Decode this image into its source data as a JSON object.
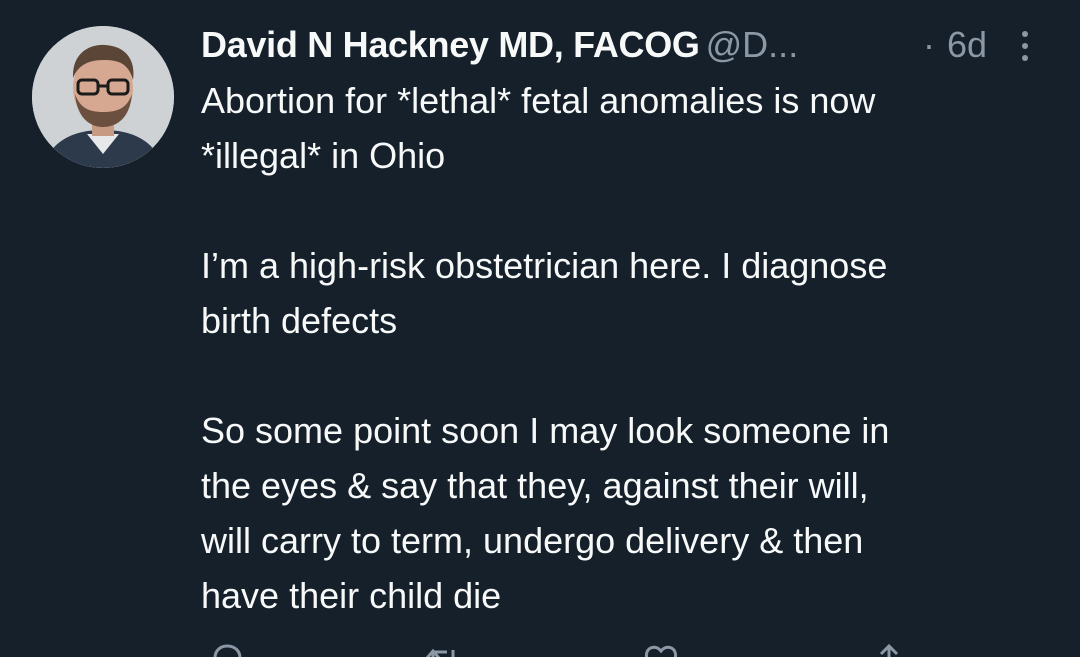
{
  "tweet": {
    "display_name": "David N Hackney MD, FACOG",
    "handle": "@D...",
    "separator": "·",
    "time": "6d",
    "more_icon": "more-vertical-icon",
    "paragraphs": [
      {
        "lines": [
          "Abortion for *lethal* fetal anomalies is now",
          "*illegal* in Ohio"
        ]
      },
      {
        "lines": [
          "I’m a high-risk obstetrician here. I diagnose",
          "birth defects"
        ]
      },
      {
        "lines": [
          "So some point soon I may look someone in",
          "the eyes & say that they, against their will,",
          "will carry to term, undergo delivery & then",
          "have their child die"
        ]
      }
    ],
    "actions": [
      {
        "name": "reply-icon"
      },
      {
        "name": "retweet-icon"
      },
      {
        "name": "like-icon"
      },
      {
        "name": "share-icon"
      }
    ]
  },
  "colors": {
    "background": "#15202b",
    "text_primary": "#f7f9f9",
    "text_secondary": "#8b98a5"
  }
}
